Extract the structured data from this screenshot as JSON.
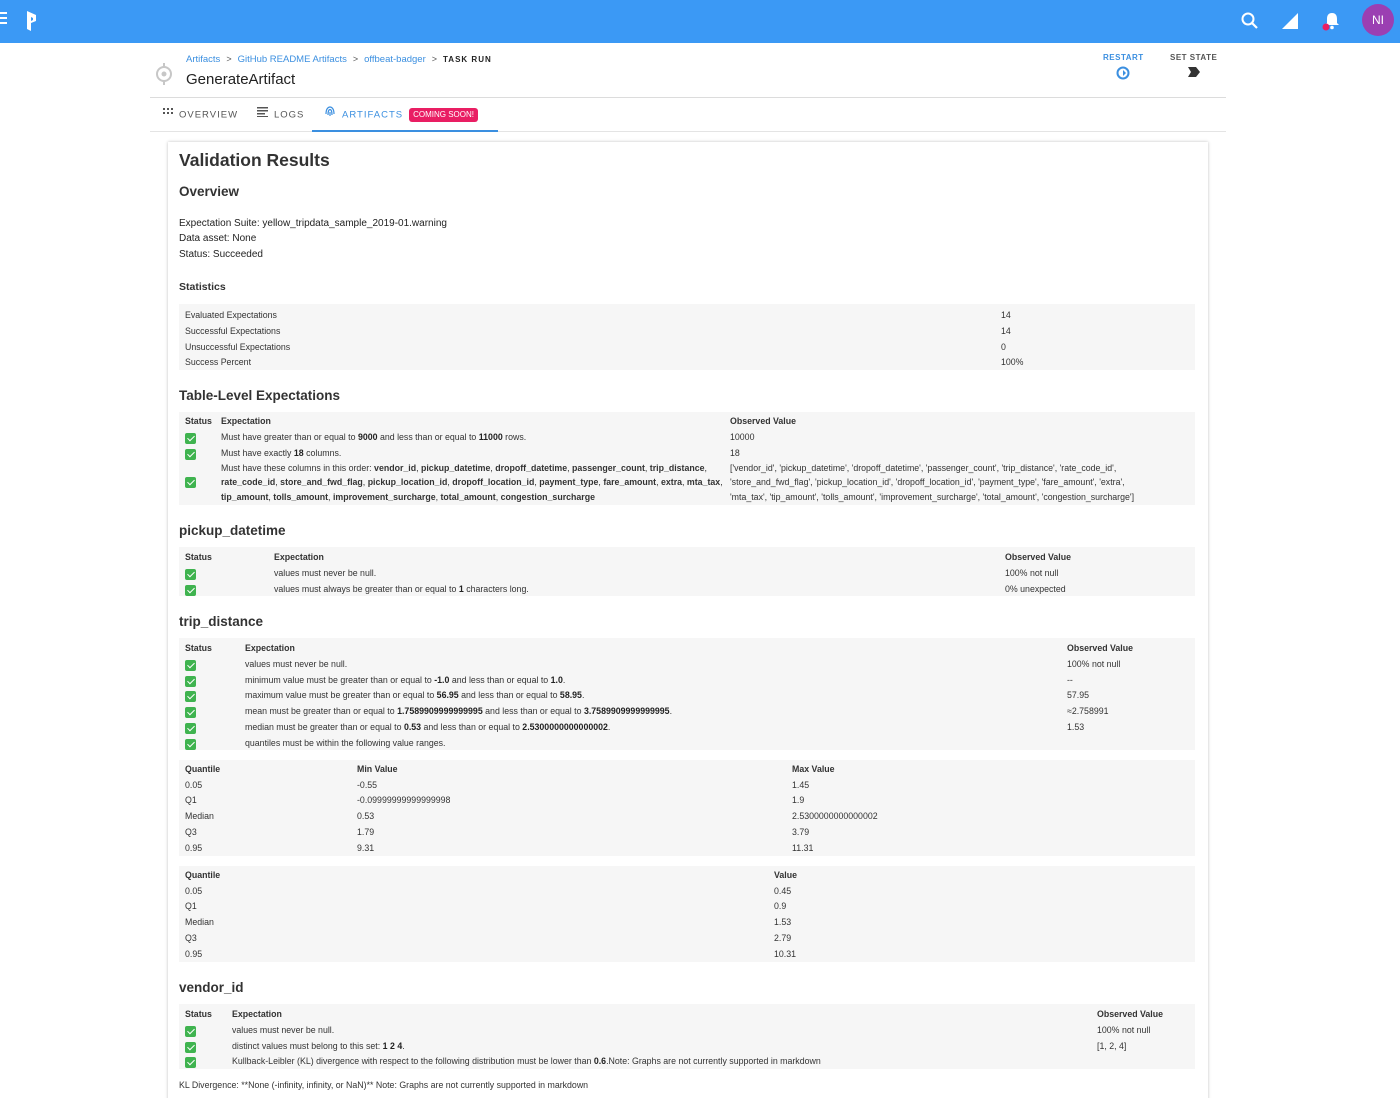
{
  "topbar": {
    "avatar_initials": "NI",
    "colors": {
      "bar": "#3b99f5",
      "avatar": "#9b3fb2",
      "notification_dot": "#e91e63"
    },
    "icons": [
      "menu-icon",
      "prefect-logo-icon",
      "search-icon",
      "signal-icon",
      "bell-icon"
    ]
  },
  "header": {
    "breadcrumb": [
      "Artifacts",
      "GitHub README Artifacts",
      "offbeat-badger"
    ],
    "breadcrumb_current": "TASK RUN",
    "title": "GenerateArtifact",
    "restart_label": "RESTART",
    "set_state_label": "SET STATE"
  },
  "tabs": {
    "overview": "OVERVIEW",
    "logs": "LOGS",
    "artifacts": "ARTIFACTS",
    "artifacts_badge": "COMING SOON!",
    "active": "artifacts"
  },
  "report": {
    "title": "Validation Results",
    "overview": {
      "heading": "Overview",
      "suite": "Expectation Suite: yellow_tripdata_sample_2019-01.warning",
      "asset": "Data asset: None",
      "status": "Status: Succeeded"
    },
    "statistics": {
      "heading": "Statistics",
      "rows": [
        [
          "Evaluated Expectations",
          "14"
        ],
        [
          "Successful Expectations",
          "14"
        ],
        [
          "Unsuccessful Expectations",
          "0"
        ],
        [
          "Success Percent",
          "100%"
        ]
      ]
    },
    "table_level": {
      "heading": "Table-Level Expectations",
      "headers": [
        "Status",
        "Expectation",
        "Observed Value"
      ],
      "rows": [
        {
          "status": "success",
          "expectation": "Must have greater than or equal to <b>9000</b> and less than or equal to <b>11000</b> rows.",
          "observed": "10000"
        },
        {
          "status": "success",
          "expectation": "Must have exactly <b>18</b> columns.",
          "observed": "18"
        },
        {
          "status": "success",
          "expectation_lines": [
            "Must have these columns in this order: <b>vendor_id</b>, <b>pickup_datetime</b>, <b>dropoff_datetime</b>, <b>passenger_count</b>, <b>trip_distance</b>,",
            "<b>rate_code_id</b>, <b>store_and_fwd_flag</b>, <b>pickup_location_id</b>, <b>dropoff_location_id</b>, <b>payment_type</b>, <b>fare_amount</b>, <b>extra</b>, <b>mta_tax</b>,",
            "<b>tip_amount</b>, <b>tolls_amount</b>, <b>improvement_surcharge</b>, <b>total_amount</b>, <b>congestion_surcharge</b>"
          ],
          "observed_lines": [
            "['vendor_id', 'pickup_datetime', 'dropoff_datetime', 'passenger_count', 'trip_distance', 'rate_code_id',",
            "'store_and_fwd_flag', 'pickup_location_id', 'dropoff_location_id', 'payment_type', 'fare_amount', 'extra',",
            "'mta_tax', 'tip_amount', 'tolls_amount', 'improvement_surcharge', 'total_amount', 'congestion_surcharge']"
          ]
        }
      ]
    },
    "pickup_datetime": {
      "heading": "pickup_datetime",
      "headers": [
        "Status",
        "Expectation",
        "Observed Value"
      ],
      "rows": [
        {
          "status": "success",
          "expectation": "values must never be null.",
          "observed": "100% not null"
        },
        {
          "status": "success",
          "expectation": "values must always be greater than or equal to <b>1</b> characters long.",
          "observed": "0% unexpected"
        }
      ]
    },
    "trip_distance": {
      "heading": "trip_distance",
      "headers": [
        "Status",
        "Expectation",
        "Observed Value"
      ],
      "rows": [
        {
          "status": "success",
          "expectation": "values must never be null.",
          "observed": "100% not null"
        },
        {
          "status": "success",
          "expectation": "minimum value must be greater than or equal to <b>-1.0</b> and less than or equal to <b>1.0</b>.",
          "observed": "--"
        },
        {
          "status": "success",
          "expectation": "maximum value must be greater than or equal to <b>56.95</b> and less than or equal to <b>58.95</b>.",
          "observed": "57.95"
        },
        {
          "status": "success",
          "expectation": "mean must be greater than or equal to <b>1.7589909999999995</b> and less than or equal to <b>3.7589909999999995</b>.",
          "observed": "≈2.758991"
        },
        {
          "status": "success",
          "expectation": "median must be greater than or equal to <b>0.53</b> and less than or equal to <b>2.5300000000000002</b>.",
          "observed": "1.53"
        },
        {
          "status": "success",
          "expectation": "quantiles must be within the following value ranges.",
          "observed": ""
        }
      ],
      "quantile_ranges": {
        "headers": [
          "Quantile",
          "Min Value",
          "Max Value"
        ],
        "rows": [
          [
            "0.05",
            "-0.55",
            "1.45"
          ],
          [
            "Q1",
            "-0.09999999999999998",
            "1.9"
          ],
          [
            "Median",
            "0.53",
            "2.5300000000000002"
          ],
          [
            "Q3",
            "1.79",
            "3.79"
          ],
          [
            "0.95",
            "9.31",
            "11.31"
          ]
        ]
      },
      "quantile_values": {
        "headers": [
          "Quantile",
          "Value"
        ],
        "rows": [
          [
            "0.05",
            "0.45"
          ],
          [
            "Q1",
            "0.9"
          ],
          [
            "Median",
            "1.53"
          ],
          [
            "Q3",
            "2.79"
          ],
          [
            "0.95",
            "10.31"
          ]
        ]
      }
    },
    "vendor_id": {
      "heading": "vendor_id",
      "headers": [
        "Status",
        "Expectation",
        "Observed Value"
      ],
      "rows": [
        {
          "status": "success",
          "expectation": "values must never be null.",
          "observed": "100% not null"
        },
        {
          "status": "success",
          "expectation": "distinct values must belong to this set: <b>1</b> <b>2</b> <b>4</b>.",
          "observed": "[1, 2, 4]"
        },
        {
          "status": "success",
          "expectation": "Kullback-Leibler (KL) divergence with respect to the following distribution must be lower than <b>0.6</b>.Note: Graphs are not currently supported in markdown",
          "observed": ""
        }
      ],
      "footnote": "KL Divergence: **None (-infinity, infinity, or NaN)** Note: Graphs are not currently supported in markdown"
    }
  }
}
